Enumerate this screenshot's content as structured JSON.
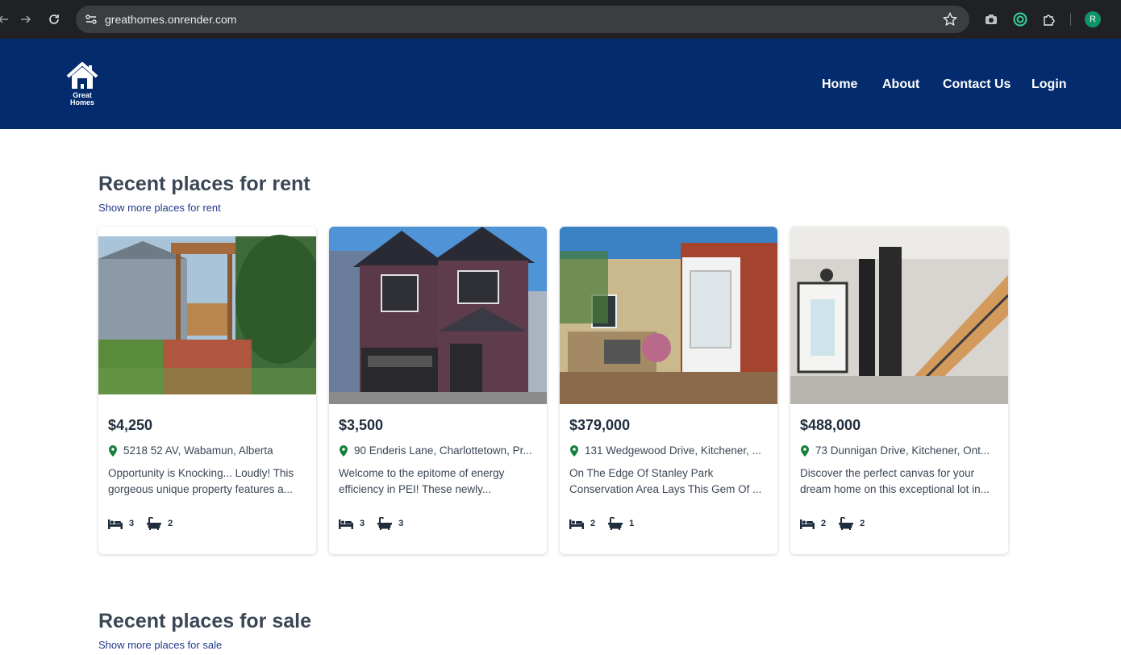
{
  "browser": {
    "url": "greathomes.onrender.com",
    "profile_initial": "R"
  },
  "site": {
    "logo_text_line1": "Great",
    "logo_text_line2": "Homes",
    "nav": [
      "Home",
      "About",
      "Contact Us",
      "Login"
    ]
  },
  "rent_section": {
    "title": "Recent places for rent",
    "link": "Show more places for rent",
    "listings": [
      {
        "price": "$4,250",
        "address": "5218 52 AV, Wabamun, Alberta",
        "description": "Opportunity is Knocking... Loudly! This gorgeous unique property features a...",
        "beds": "3",
        "baths": "2"
      },
      {
        "price": "$3,500",
        "address": "90 Enderis Lane, Charlottetown, Pr...",
        "description": "Welcome to the epitome of energy efficiency in PEI! These newly...",
        "beds": "3",
        "baths": "3"
      },
      {
        "price": "$379,000",
        "address": "131 Wedgewood Drive, Kitchener, ...",
        "description": "On The Edge Of Stanley Park Conservation Area Lays This Gem Of ...",
        "beds": "2",
        "baths": "1"
      },
      {
        "price": "$488,000",
        "address": "73 Dunnigan Drive, Kitchener, Ont...",
        "description": "Discover the perfect canvas for your dream home on this exceptional lot in...",
        "beds": "2",
        "baths": "2"
      }
    ]
  },
  "sale_section": {
    "title": "Recent places for sale",
    "link": "Show more places for sale"
  },
  "colors": {
    "header_bg": "#032b6e",
    "link": "#1e3a8a",
    "pin": "#15803d"
  }
}
